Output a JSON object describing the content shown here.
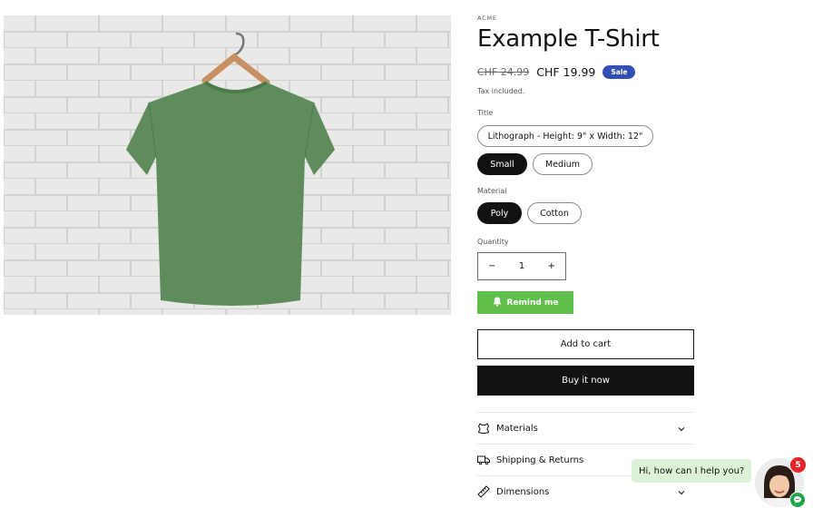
{
  "product": {
    "image_alt": "Green t-shirt on hanger against white brick wall",
    "vendor": "ACME",
    "title": "Example T-Shirt",
    "compare_price": "CHF 24.99",
    "price": "CHF 19.99",
    "sale_badge": "Sale",
    "tax_note": "Tax included."
  },
  "options": {
    "title_label": "Title",
    "title_values": [
      "Lithograph - Height: 9\" x Width: 12\"",
      "Small",
      "Medium"
    ],
    "title_selected": "Small",
    "material_label": "Material",
    "material_values": [
      "Poly",
      "Cotton"
    ],
    "material_selected": "Poly"
  },
  "quantity": {
    "label": "Quantity",
    "value": "1",
    "minus": "−",
    "plus": "+"
  },
  "actions": {
    "remind_me": "Remind me",
    "add_to_cart": "Add to cart",
    "buy_now": "Buy it now"
  },
  "accordion": [
    {
      "label": "Materials",
      "icon": "leather-icon"
    },
    {
      "label": "Shipping & Returns",
      "icon": "truck-icon"
    },
    {
      "label": "Dimensions",
      "icon": "ruler-icon"
    }
  ],
  "chat": {
    "greeting": "Hi, how can I help you?",
    "unread_count": "5"
  },
  "colors": {
    "sale_badge": "#334fb4",
    "remind_button": "#5fbf4b",
    "selected_pill": "#121212",
    "chat_bubble": "#dcf1d5",
    "unread_badge": "#e4252c",
    "chat_icon": "#1ea64a"
  }
}
